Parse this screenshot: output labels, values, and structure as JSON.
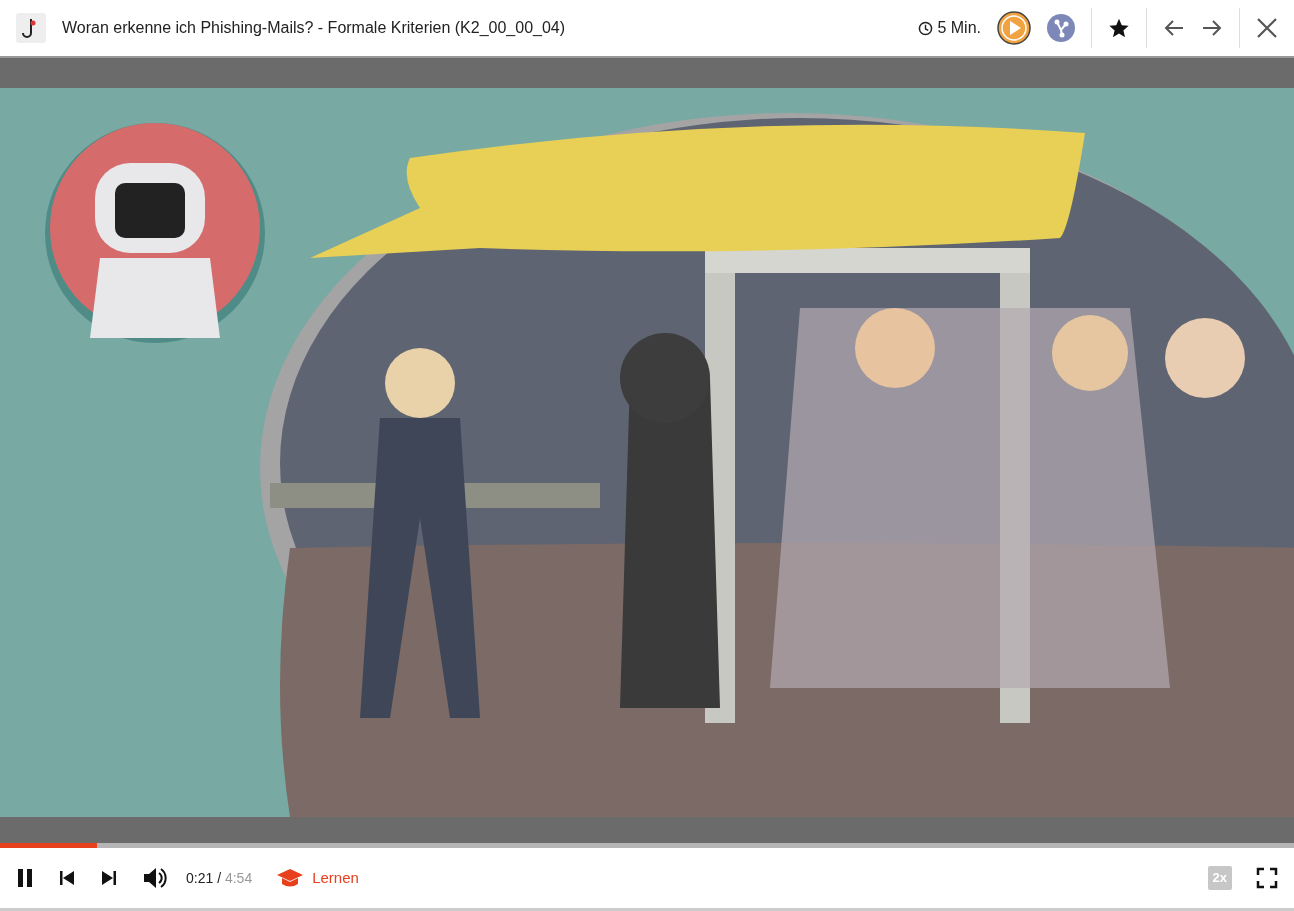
{
  "header": {
    "title": "Woran erkenne ich Phishing-Mails? - Formale Kriterien (K2_00_00_04)",
    "duration": "5 Min."
  },
  "player": {
    "playing": true,
    "progress": {
      "level": 0.075
    },
    "current_time": "0:21",
    "separator": "/",
    "total_time": "4:54",
    "learn_button": "Lernen",
    "speed": "2x"
  }
}
